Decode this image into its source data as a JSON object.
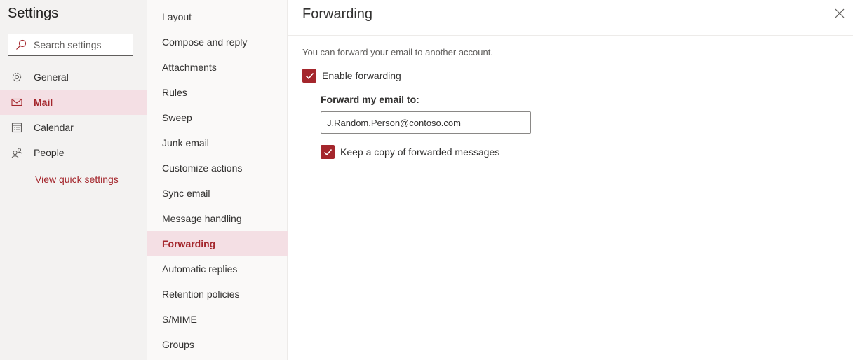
{
  "settings_panel": {
    "title": "Settings",
    "search_placeholder": "Search settings",
    "nav": [
      {
        "label": "General",
        "icon": "gear-icon"
      },
      {
        "label": "Mail",
        "icon": "mail-icon"
      },
      {
        "label": "Calendar",
        "icon": "calendar-icon"
      },
      {
        "label": "People",
        "icon": "people-icon"
      }
    ],
    "quick_settings_link": "View quick settings"
  },
  "categories": [
    "Layout",
    "Compose and reply",
    "Attachments",
    "Rules",
    "Sweep",
    "Junk email",
    "Customize actions",
    "Sync email",
    "Message handling",
    "Forwarding",
    "Automatic replies",
    "Retention policies",
    "S/MIME",
    "Groups"
  ],
  "main": {
    "title": "Forwarding",
    "description": "You can forward your email to another account.",
    "enable_forwarding_label": "Enable forwarding",
    "forward_to_label": "Forward my email to:",
    "forward_to_value": "J.Random.Person@contoso.com",
    "keep_copy_label": "Keep a copy of forwarded messages"
  },
  "colors": {
    "accent": "#a4262c",
    "selected_bg": "#f4dfe4"
  }
}
